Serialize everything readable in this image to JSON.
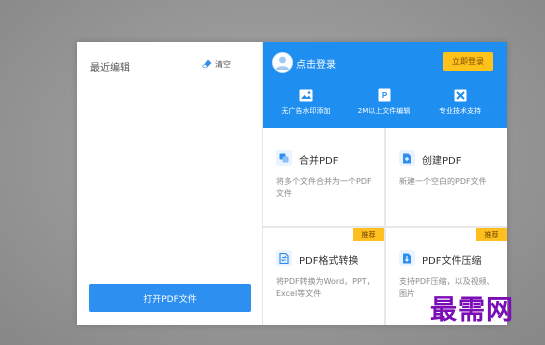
{
  "left": {
    "recent_title": "最近编辑",
    "clear_label": "清空",
    "open_button": "打开PDF文件"
  },
  "header": {
    "login_label": "点击登录",
    "login_now": "立即登录",
    "features": [
      {
        "icon": "no-watermark-icon",
        "label": "无广告水印添加"
      },
      {
        "icon": "large-file-edit-icon",
        "label": "2M以上文件编辑"
      },
      {
        "icon": "tech-support-icon",
        "label": "专业技术支持"
      }
    ]
  },
  "cards": [
    {
      "title": "合并PDF",
      "desc": "将多个文件合并为一个PDF文件",
      "icon": "merge-icon",
      "badge": ""
    },
    {
      "title": "创建PDF",
      "desc": "新建一个空白的PDF文件",
      "icon": "create-icon",
      "badge": ""
    },
    {
      "title": "PDF格式转换",
      "desc": "将PDF转换为Word，PPT，Excel等文件",
      "icon": "convert-icon",
      "badge": "推荐"
    },
    {
      "title": "PDF文件压缩",
      "desc": "支持PDF压缩，以及视频、图片",
      "icon": "compress-icon",
      "badge": "推荐"
    }
  ],
  "watermark": "最需网",
  "colors": {
    "accent": "#1f8ef1",
    "badge": "#ffbf1f",
    "button": "#2d8ff0"
  }
}
